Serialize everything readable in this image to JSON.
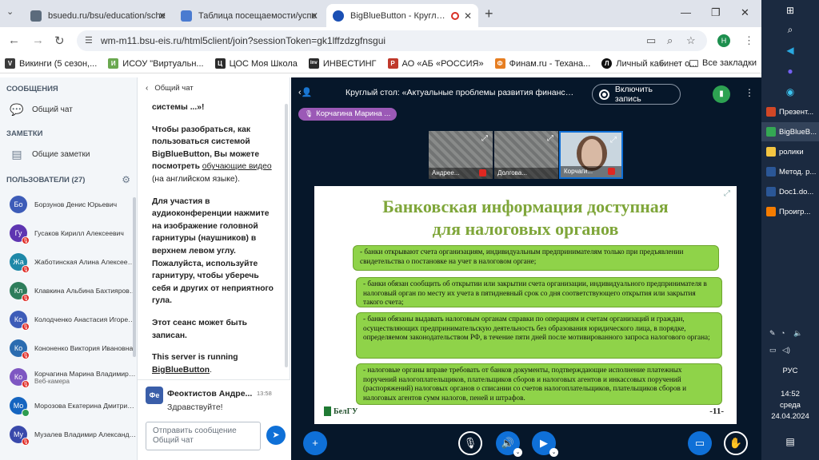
{
  "browser": {
    "tabs": [
      {
        "label": "bsuedu.ru/bsu/education/sche",
        "color": "#5b6b7c",
        "active": false
      },
      {
        "label": "Таблица посещаемости/успе",
        "color": "#4a7bd0",
        "active": false
      },
      {
        "label": "BigBlueButton - Круглый с",
        "color": "#1a4fb4",
        "active": true
      }
    ],
    "url": "wm-m11.bsu-eis.ru/html5client/join?sessionToken=gk1lffzdzgfnsgui",
    "profile_letter": "H",
    "bookmarks": [
      {
        "label": "Викинги (5 сезон,...",
        "color": "#3b3b3b",
        "glyph": "V"
      },
      {
        "label": "ИСОУ \"Виртуальн...",
        "color": "#6aa84f",
        "glyph": "И"
      },
      {
        "label": "ЦОС Моя Школа",
        "color": "#2b2b2b",
        "glyph": "Ц"
      },
      {
        "label": "ИНВЕСТИНГ",
        "color": "#2b2b2b",
        "glyph": "Inv"
      },
      {
        "label": "АО «АБ «РОССИЯ»",
        "color": "#c0392b",
        "glyph": "Р"
      },
      {
        "label": "Финам.ru - Техана...",
        "color": "#e67e22",
        "glyph": "Ф"
      },
      {
        "label": "Личный кабинет о...",
        "color": "#111111",
        "glyph": "Л"
      }
    ],
    "bookmarks_more": "»",
    "all_bookmarks": "Все закладки"
  },
  "sidebar": {
    "messages_title": "СООБЩЕНИЯ",
    "public_chat": "Общий чат",
    "notes_title": "ЗАМЕТКИ",
    "shared_notes": "Общие заметки",
    "users_title": "ПОЛЬЗОВАТЕЛИ (27)",
    "users": [
      {
        "initials": "Бо",
        "name": "Борзунов Денис Юрьевич",
        "color": "#3d5cb8",
        "status": "none",
        "sub": ""
      },
      {
        "initials": "Гу",
        "name": "Гусаков Кирилл Алексеевич",
        "color": "#5e35b1",
        "status": "muted",
        "sub": ""
      },
      {
        "initials": "Жа",
        "name": "Жаботинская Алина Алексеевна",
        "color": "#1e88a8",
        "status": "muted",
        "sub": ""
      },
      {
        "initials": "Кл",
        "name": "Клавкина Альбина Бахтияровна",
        "color": "#2e7d5b",
        "status": "muted",
        "sub": ""
      },
      {
        "initials": "Ко",
        "name": "Колодченко Анастасия Игоревна",
        "color": "#3d5cb8",
        "status": "muted",
        "sub": ""
      },
      {
        "initials": "Ко",
        "name": "Кононенко Виктория Ивановна",
        "color": "#2b6cb0",
        "status": "muted",
        "sub": ""
      },
      {
        "initials": "Ко",
        "name": "Корчагина Марина Владимиро...",
        "color": "#7e57c2",
        "status": "muted",
        "sub": "Веб-камера"
      },
      {
        "initials": "Мо",
        "name": "Морозова Екатерина Дмитрие...",
        "color": "#1565c0",
        "status": "listen",
        "sub": ""
      },
      {
        "initials": "Му",
        "name": "Музалев Владимир Александр...",
        "color": "#3949ab",
        "status": "muted",
        "sub": ""
      }
    ]
  },
  "chat": {
    "header": "Общий чат",
    "welcome": {
      "p1": "системы ...»!",
      "p2a": "Чтобы разобраться, как пользоваться системой BigBlueButton, ",
      "p2b": "Вы можете посмотреть ",
      "p2c": "обучающие видео",
      "p2d": " (на английском языке).",
      "p3a": "Для участия в аудиоконференции нажмите на изображение головной гарнитуры (наушников) в верхнем левом углу. ",
      "p3b": "Пожалуйста, используйте гарнитуру, чтобы уберечь себя и других от неприятного гула.",
      "p4": "Этот сеанс может быть записан.",
      "p5a": "This server is running ",
      "p5b": "BigBlueButton",
      "p5c": "."
    },
    "message": {
      "avatar": "Фе",
      "author": "Феоктистов Андре...",
      "time": "13:58",
      "text": "Здравствуйте!"
    },
    "input_placeholder": "Отправить сообщение Общий чат"
  },
  "meeting": {
    "title": "Круглый стол: «Актуальные проблемы развития финансово...",
    "record_label": "Включить запись",
    "talker": "Корчагина Марина ...",
    "cameras": [
      {
        "name": "Андрее...",
        "active": false
      },
      {
        "name": "Долгова...",
        "active": false
      },
      {
        "name": "Корчаги...",
        "active": true
      }
    ]
  },
  "slide": {
    "title_line1": "Банковская информация доступная",
    "title_line2": "для налоговых органов",
    "bullets": [
      "-  банки открывают счета организациям, индивидуальным предпринимателям только при предъявлении свидетельства о постановке на учет в налоговом органе;",
      "-  банки обязан сообщить об открытии или закрытии счета организации, индивидуального предпринимателя в налоговый орган по месту их учета в пятидневный срок со дня соответствующего открытия или закрытия  такого счета;",
      "-     банки обязаны выдавать налоговым органам справки по операциям и счетам организаций и граждан, осуществляющих предпринимательскую деятельность без образования юридического лица, в порядке, определяемом законодательством РФ, в течение пяти дней после мотивированного запроса налогового органа;",
      "-     налоговые органы вправе требовать от банков документы, подтверждающие  исполнение платежных поручений налогоплательщиков, плательщиков сборов и налоговых агентов и инкассовых поручений (распоряжений) налоговых органов о списании со счетов налогоплательщиков, плательщиков сборов и налоговых агентов сумм налогов, пеней и штрафов."
    ],
    "logo_text": "БелГУ",
    "page": "-11-"
  },
  "taskbar": {
    "apps": [
      {
        "label": "Презент...",
        "color": "#d24726",
        "selected": false
      },
      {
        "label": "BigBlueB...",
        "color": "#34a853",
        "selected": true
      },
      {
        "label": "ролики",
        "color": "#f4c542",
        "selected": false
      },
      {
        "label": "Метод. р...",
        "color": "#2b5797",
        "selected": false
      },
      {
        "label": "Doc1.do...",
        "color": "#2b5797",
        "selected": false
      },
      {
        "label": "Проигр...",
        "color": "#f57c00",
        "selected": false
      }
    ],
    "lang": "РУС",
    "time": "14:52",
    "day": "среда",
    "date": "24.04.2024"
  }
}
